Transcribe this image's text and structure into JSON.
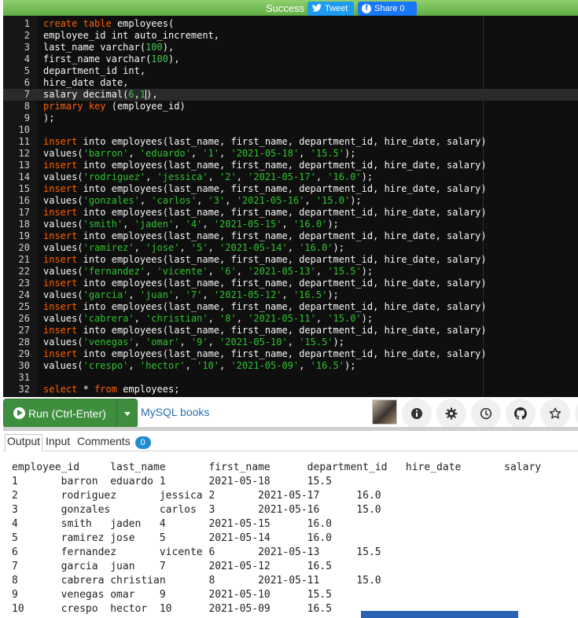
{
  "topbar": {
    "status": "Success",
    "tweet_label": "Tweet",
    "share_label": "Share 0"
  },
  "editor": {
    "lines": [
      "create table employees(",
      "employee_id int auto_increment,",
      "last_name varchar(100),",
      "first_name varchar(100),",
      "department_id int,",
      "hire_date date,",
      "salary decimal(6,1),",
      "primary key (employee_id)",
      ");",
      "",
      "insert into employees(last_name, first_name, department_id, hire_date, salary)",
      "values('barron', 'eduardo', '1', '2021-05-18', '15.5');",
      "insert into employees(last_name, first_name, department_id, hire_date, salary)",
      "values('rodriguez', 'jessica', '2', '2021-05-17', '16.0');",
      "insert into employees(last_name, first_name, department_id, hire_date, salary)",
      "values('gonzales', 'carlos', '3', '2021-05-16', '15.0');",
      "insert into employees(last_name, first_name, department_id, hire_date, salary)",
      "values('smith', 'jaden', '4', '2021-05-15', '16.0');",
      "insert into employees(last_name, first_name, department_id, hire_date, salary)",
      "values('ramirez', 'jose', '5', '2021-05-14', '16.0');",
      "insert into employees(last_name, first_name, department_id, hire_date, salary)",
      "values('fernandez', 'vicente', '6', '2021-05-13', '15.5');",
      "insert into employees(last_name, first_name, department_id, hire_date, salary)",
      "values('garcia', 'juan', '7', '2021-05-12', '16.5');",
      "insert into employees(last_name, first_name, department_id, hire_date, salary)",
      "values('cabrera', 'christian', '8', '2021-05-11', '15.0');",
      "insert into employees(last_name, first_name, department_id, hire_date, salary)",
      "values('venegas', 'omar', '9', '2021-05-10', '15.5');",
      "insert into employees(last_name, first_name, department_id, hire_date, salary)",
      "values('crespo', 'hector', '10', '2021-05-09', '16.5');",
      "",
      "select * from employees;"
    ],
    "active_line": 7
  },
  "toolbar": {
    "run_label": "Run (Ctrl-Enter)",
    "books_link": "MySQL books",
    "tools": [
      "info-icon",
      "gear-icon",
      "history-icon",
      "github-icon",
      "star-icon"
    ]
  },
  "output_tabs": {
    "output": "Output",
    "input": "Input",
    "comments": "Comments",
    "comments_count": "0"
  },
  "output": {
    "lines": [
      "employee_id\tlast_name\tfirst_name\tdepartment_id\thire_date\tsalary",
      "1\tbarron\teduardo\t1\t2021-05-18\t15.5",
      "2\trodriguez\tjessica\t2\t2021-05-17\t16.0",
      "3\tgonzales\tcarlos\t3\t2021-05-16\t15.0",
      "4\tsmith\tjaden\t4\t2021-05-15\t16.0",
      "5\tramirez\tjose\t5\t2021-05-14\t16.0",
      "6\tfernandez\tvicente\t6\t2021-05-13\t15.5",
      "7\tgarcia\tjuan\t7\t2021-05-12\t16.5",
      "8\tcabrera\tchristian\t8\t2021-05-11\t15.0",
      "9\tvenegas\tomar\t9\t2021-05-10\t15.5",
      "10\tcrespo\thector\t10\t2021-05-09\t16.5"
    ]
  },
  "colors": {
    "success_bar": "#5fae45",
    "editor_bg": "#0f0f0f",
    "keyword": "#ff6000",
    "string": "#2ec42e",
    "run_button": "#3e8e3e",
    "badge": "#1f8ccf"
  }
}
